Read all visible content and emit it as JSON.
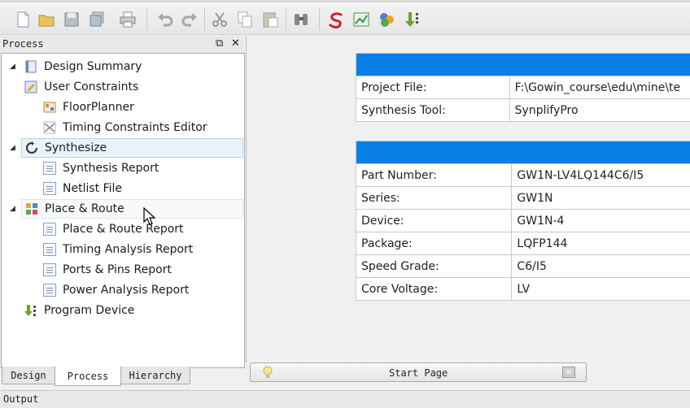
{
  "toolbar": {
    "icons": [
      "new-file-icon",
      "open-folder-icon",
      "save-icon",
      "save-all-icon",
      "print-icon",
      "undo-icon",
      "redo-icon",
      "cut-icon",
      "copy-icon",
      "paste-icon",
      "find-icon",
      "synplify-icon",
      "floorplanner-icon",
      "ip-core-icon",
      "program-device-icon"
    ]
  },
  "process_panel": {
    "title": "Process",
    "pin_glyph": "⧉",
    "close_glyph": "✕",
    "items": [
      {
        "label": "Design Summary"
      },
      {
        "label": "User Constraints",
        "expanded": true
      },
      {
        "label": "FloorPlanner"
      },
      {
        "label": "Timing Constraints Editor"
      },
      {
        "label": "Synthesize",
        "expanded": true,
        "selected": true
      },
      {
        "label": "Synthesis Report"
      },
      {
        "label": "Netlist File"
      },
      {
        "label": "Place & Route",
        "expanded": true
      },
      {
        "label": "Place & Route Report"
      },
      {
        "label": "Timing Analysis Report"
      },
      {
        "label": "Ports & Pins Report"
      },
      {
        "label": "Power Analysis Report"
      },
      {
        "label": "Program Device"
      }
    ]
  },
  "bottom_tabs": [
    "Design",
    "Process",
    "Hierarchy"
  ],
  "active_bottom_tab": "Process",
  "output_label": "Output",
  "project_table": [
    {
      "key": "Project File:",
      "value": "F:\\Gowin_course\\edu\\mine\\te"
    },
    {
      "key": "Synthesis Tool:",
      "value": "SynplifyPro"
    }
  ],
  "device_table": [
    {
      "key": "Part Number:",
      "value": "GW1N-LV4LQ144C6/I5"
    },
    {
      "key": "Series:",
      "value": "GW1N"
    },
    {
      "key": "Device:",
      "value": "GW1N-4"
    },
    {
      "key": "Package:",
      "value": "LQFP144"
    },
    {
      "key": "Speed Grade:",
      "value": "C6/I5"
    },
    {
      "key": "Core Voltage:",
      "value": "LV"
    }
  ],
  "start_page_tab": {
    "title": "Start Page",
    "close_glyph": "✕"
  },
  "colors": {
    "header_blue": "#0a80e6",
    "selection": "#eaf3fc"
  }
}
